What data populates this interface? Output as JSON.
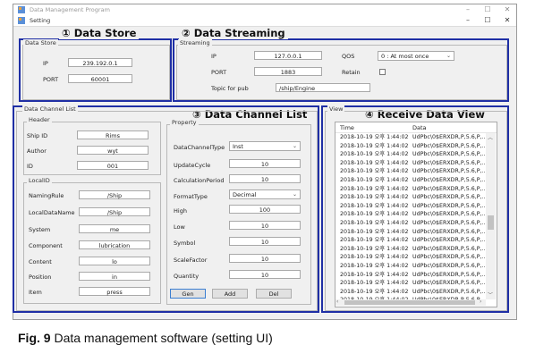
{
  "window": {
    "app_title": "Data Management Program",
    "tab_title": "Setting",
    "controls": {
      "minimize": "–",
      "maximize": "☐",
      "close": "✕"
    }
  },
  "annotations": {
    "data_store": "① Data Store",
    "data_streaming": "② Data Streaming",
    "data_channel_list": "③ Data Channel List",
    "receive_data_view": "④ Receive Data View"
  },
  "data_store": {
    "group_label": "Data Store",
    "ip_label": "IP",
    "ip_value": "239.192.0.1",
    "port_label": "PORT",
    "port_value": "60001"
  },
  "streaming": {
    "group_label": "Streaming",
    "ip_label": "IP",
    "ip_value": "127.0.0.1",
    "port_label": "PORT",
    "port_value": "1883",
    "topic_label": "Topic for pub",
    "topic_value": "/ship/Engine",
    "qos_label": "QOS",
    "qos_value": "0 : At most once",
    "retain_label": "Retain",
    "retain_checked": false
  },
  "channel_list": {
    "group_label": "Data Channel List",
    "header": {
      "label": "Header",
      "ship_id_label": "Ship ID",
      "ship_id_value": "Rims",
      "author_label": "Author",
      "author_value": "wyt",
      "id_label": "ID",
      "id_value": "001"
    },
    "local_id": {
      "label": "LocalID",
      "naming_rule_label": "NamingRule",
      "naming_rule_value": "/Ship",
      "local_data_name_label": "LocalDataName",
      "local_data_name_value": "/Ship",
      "system_label": "System",
      "system_value": "me",
      "component_label": "Component",
      "component_value": "lubrication",
      "content_label": "Content",
      "content_value": "lo",
      "position_label": "Position",
      "position_value": "in",
      "item_label": "Item",
      "item_value": "press"
    },
    "property": {
      "label": "Property",
      "channel_type_label": "DataChannelType",
      "channel_type_value": "Inst",
      "update_cycle_label": "UpdateCycle",
      "update_cycle_value": "10",
      "calc_period_label": "CalculationPeriod",
      "calc_period_value": "10",
      "format_type_label": "FormatType",
      "format_type_value": "Decimal",
      "high_label": "High",
      "high_value": "100",
      "low_label": "Low",
      "low_value": "10",
      "symbol_label": "Symbol",
      "symbol_value": "10",
      "scale_factor_label": "ScaleFactor",
      "scale_factor_value": "10",
      "quantity_label": "Quantity",
      "quantity_value": "10"
    },
    "buttons": {
      "gen": "Gen",
      "add": "Add",
      "del": "Del"
    }
  },
  "view": {
    "group_label": "View",
    "columns": [
      "Time",
      "Data"
    ],
    "rows": [
      {
        "time": "2018-10-19 오후 1:44:02",
        "data": "UdPbc\\0$ERXDR,P,5.6,P,..."
      },
      {
        "time": "2018-10-19 오후 1:44:02",
        "data": "UdPbc\\0$ERXDR,P,5.6,P,..."
      },
      {
        "time": "2018-10-19 오후 1:44:02",
        "data": "UdPbc\\0$ERXDR,P,5.6,P,..."
      },
      {
        "time": "2018-10-19 오후 1:44:02",
        "data": "UdPbc\\0$ERXDR,P,5.6,P,..."
      },
      {
        "time": "2018-10-19 오후 1:44:02",
        "data": "UdPbc\\0$ERXDR,P,5.6,P,..."
      },
      {
        "time": "2018-10-19 오후 1:44:02",
        "data": "UdPbc\\0$ERXDR,P,5.6,P,..."
      },
      {
        "time": "2018-10-19 오후 1:44:02",
        "data": "UdPbc\\0$ERXDR,P,5.6,P,..."
      },
      {
        "time": "2018-10-19 오후 1:44:02",
        "data": "UdPbc\\0$ERXDR,P,5.6,P,..."
      },
      {
        "time": "2018-10-19 오후 1:44:02",
        "data": "UdPbc\\0$ERXDR,P,5.6,P,..."
      },
      {
        "time": "2018-10-19 오후 1:44:02",
        "data": "UdPbc\\0$ERXDR,P,5.6,P,..."
      },
      {
        "time": "2018-10-19 오후 1:44:02",
        "data": "UdPbc\\0$ERXDR,P,5.6,P,..."
      },
      {
        "time": "2018-10-19 오후 1:44:02",
        "data": "UdPbc\\0$ERXDR,P,5.6,P,..."
      },
      {
        "time": "2018-10-19 오후 1:44:02",
        "data": "UdPbc\\0$ERXDR,P,5.6,P,..."
      },
      {
        "time": "2018-10-19 오후 1:44:02",
        "data": "UdPbc\\0$ERXDR,P,5.6,P,..."
      },
      {
        "time": "2018-10-19 오후 1:44:02",
        "data": "UdPbc\\0$ERXDR,P,5.6,P,..."
      },
      {
        "time": "2018-10-19 오후 1:44:02",
        "data": "UdPbc\\0$ERXDR,P,5.6,P,..."
      },
      {
        "time": "2018-10-19 오후 1:44:02",
        "data": "UdPbc\\0$ERXDR,P,5.6,P,..."
      },
      {
        "time": "2018-10-19 오후 1:44:02",
        "data": "UdPbc\\0$ERXDR,P,5.6,P,..."
      },
      {
        "time": "2018-10-19 오후 1:44:02",
        "data": "UdPbc\\0$ERXDR,P,5.6,P,..."
      },
      {
        "time": "2018-10-19 오후 1:44:02",
        "data": "UdPbc\\0$ERXDR,P,5.6,P,..."
      }
    ]
  },
  "caption": {
    "prefix": "Fig. 9",
    "text": "Data management software (setting UI)"
  },
  "colors": {
    "highlight": "#1f2fa5",
    "window_bg": "#f0f0f0"
  }
}
